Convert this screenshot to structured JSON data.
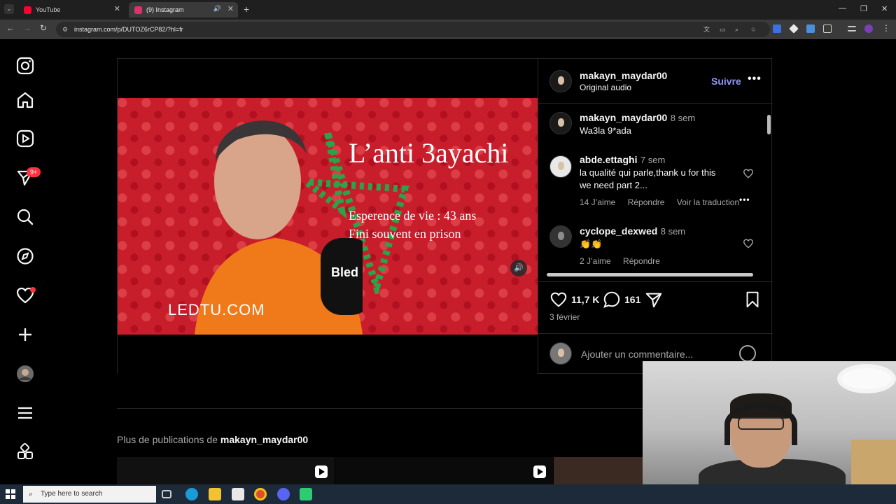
{
  "browser": {
    "tabs": [
      {
        "title": "YouTube",
        "favicon_color": "#ff0033"
      },
      {
        "title": "(9) Instagram",
        "favicon_color": "#e1306c"
      }
    ],
    "url": "instagram.com/p/DUTOZ6rCP82/?hl=fr",
    "new_tab": "+"
  },
  "nav": {
    "notifications_badge": "9+"
  },
  "post": {
    "author": "makayn_maydar00",
    "audio": "Original audio",
    "follow_label": "Suivre",
    "video_text": {
      "headline": "L’anti 3ayachi",
      "line1": "Esperence de vie : 43 ans",
      "line2": "Fini souvent en prison",
      "watermark": "LEDTU.COM"
    },
    "comments": [
      {
        "user": "makayn_maydar00",
        "time": "8 sem",
        "text": "Wa3la 9*ada"
      },
      {
        "user": "abde.ettaghi",
        "time": "7 sem",
        "text_lines": [
          "la qualité qui parle,thank u for this",
          "we need part 2..."
        ],
        "likes": "14 J’aime",
        "reply": "Répondre",
        "translate": "Voir la traduction"
      },
      {
        "user": "cyclope_dexwed",
        "time": "8 sem",
        "text": "👏👏",
        "likes": "2 J’aime",
        "reply": "Répondre"
      }
    ],
    "like_count": "11,7 K",
    "comment_count": "161",
    "date": "3 février",
    "add_comment_placeholder": "Ajouter un commentaire..."
  },
  "more_posts": {
    "prefix": "Plus de publications de",
    "user": "makayn_maydar00"
  },
  "taskbar": {
    "search_placeholder": "Type here to search"
  },
  "colors": {
    "accent_follow": "#8e95ff",
    "video_bg": "#c81e2b",
    "badge": "#ff3040"
  }
}
